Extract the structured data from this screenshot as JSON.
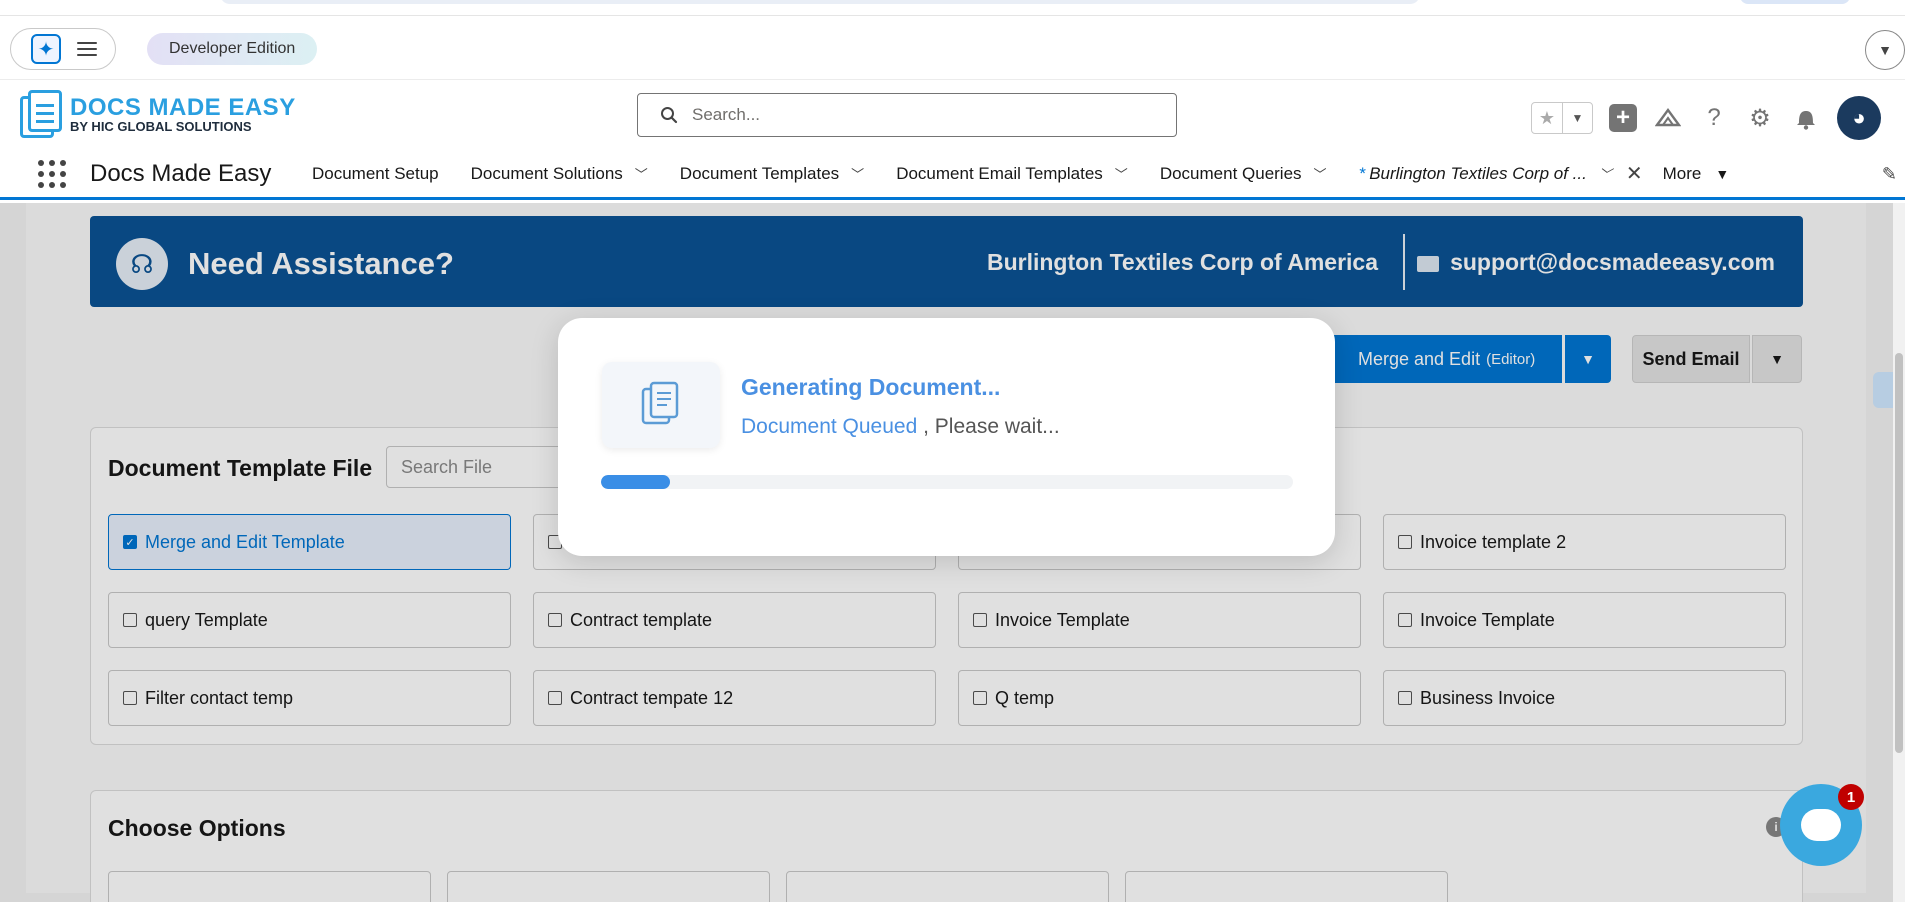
{
  "utility": {
    "edition_label": "Developer Edition"
  },
  "header": {
    "logo_line1": "DOCS MADE EASY",
    "logo_line2": "BY HIC GLOBAL SOLUTIONS",
    "search_placeholder": "Search..."
  },
  "nav": {
    "app_name": "Docs Made Easy",
    "items": [
      {
        "label": "Document Setup",
        "has_menu": false
      },
      {
        "label": "Document Solutions",
        "has_menu": true
      },
      {
        "label": "Document Templates",
        "has_menu": true
      },
      {
        "label": "Document Email Templates",
        "has_menu": true
      },
      {
        "label": "Document Queries",
        "has_menu": true
      }
    ],
    "active_tab": {
      "prefix": "*",
      "label": "Burlington Textiles Corp of ..."
    },
    "more_label": "More"
  },
  "assist": {
    "title": "Need Assistance?",
    "account": "Burlington Textiles Corp of America",
    "email": "support@docsmadeeasy.com"
  },
  "actions": {
    "merge_label": "Merge and Edit",
    "merge_sub": "(Editor)",
    "send_email_label": "Send Email"
  },
  "template_panel": {
    "title": "Document Template File",
    "search_placeholder": "Search File",
    "templates": [
      {
        "label": "Merge and Edit Template",
        "checked": true
      },
      {
        "label": "",
        "checked": false
      },
      {
        "label": "",
        "checked": false
      },
      {
        "label": "Invoice template 2",
        "checked": false
      },
      {
        "label": "query Template",
        "checked": false
      },
      {
        "label": "Contract template",
        "checked": false
      },
      {
        "label": "Invoice Template",
        "checked": false
      },
      {
        "label": "Invoice Template",
        "checked": false
      },
      {
        "label": "Filter contact temp",
        "checked": false
      },
      {
        "label": "Contract tempate 12",
        "checked": false
      },
      {
        "label": "Q temp",
        "checked": false
      },
      {
        "label": "Business Invoice",
        "checked": false
      }
    ]
  },
  "options_panel": {
    "title": "Choose Options"
  },
  "modal": {
    "title": "Generating Document...",
    "status_highlight": "Document Queued",
    "status_rest": ", Please wait...",
    "progress": 0.1
  },
  "chat": {
    "badge_count": "1"
  },
  "colors": {
    "brand": "#0176d3",
    "assist_bg": "#0b5394",
    "logo_blue": "#2a9fe0",
    "modal_accent": "#4a90e2"
  }
}
